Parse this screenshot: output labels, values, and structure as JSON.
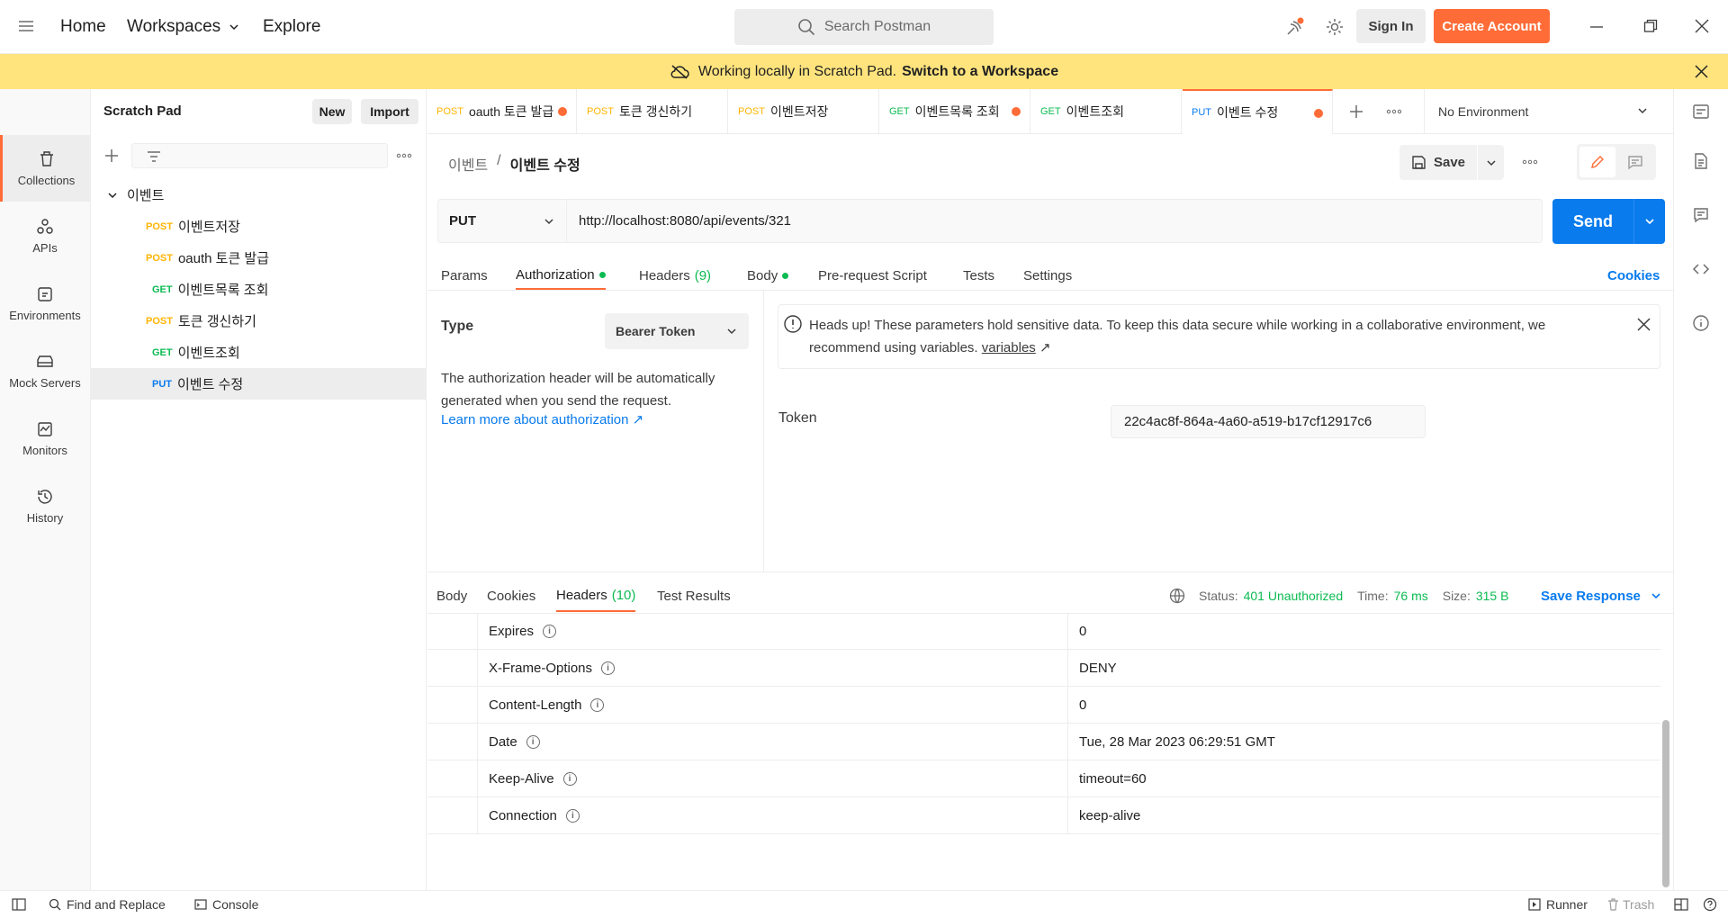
{
  "topbar": {
    "home": "Home",
    "workspaces": "Workspaces",
    "explore": "Explore",
    "search_placeholder": "Search Postman",
    "sign_in": "Sign In",
    "create_account": "Create Account"
  },
  "banner": {
    "text": "Working locally in Scratch Pad.",
    "link": "Switch to a Workspace"
  },
  "rail": {
    "items": [
      {
        "label": "Collections"
      },
      {
        "label": "APIs"
      },
      {
        "label": "Environments"
      },
      {
        "label": "Mock Servers"
      },
      {
        "label": "Monitors"
      },
      {
        "label": "History"
      }
    ]
  },
  "sidebar": {
    "title": "Scratch Pad",
    "new_label": "New",
    "import_label": "Import",
    "collection_name": "이벤트",
    "items": [
      {
        "method": "POST",
        "name": "이벤트저장"
      },
      {
        "method": "POST",
        "name": "oauth 토큰 발급"
      },
      {
        "method": "GET",
        "name": "이벤트목록 조회"
      },
      {
        "method": "POST",
        "name": "토큰 갱신하기"
      },
      {
        "method": "GET",
        "name": "이벤트조회"
      },
      {
        "method": "PUT",
        "name": "이벤트 수정"
      }
    ]
  },
  "tabs": [
    {
      "method": "POST",
      "name": "oauth 토큰 발급"
    },
    {
      "method": "POST",
      "name": "토큰 갱신하기"
    },
    {
      "method": "POST",
      "name": "이벤트저장"
    },
    {
      "method": "GET",
      "name": "이벤트목록 조회"
    },
    {
      "method": "GET",
      "name": "이벤트조회"
    },
    {
      "method": "PUT",
      "name": "이벤트 수정"
    }
  ],
  "environment": "No Environment",
  "request": {
    "breadcrumb_parent": "이벤트",
    "breadcrumb_sep": "/",
    "breadcrumb_current": "이벤트 수정",
    "save_label": "Save",
    "method": "PUT",
    "url": "http://localhost:8080/api/events/321",
    "send_label": "Send",
    "subtabs": {
      "params": "Params",
      "authorization": "Authorization",
      "headers": "Headers",
      "headers_count": "(9)",
      "body": "Body",
      "prerequest": "Pre-request Script",
      "tests": "Tests",
      "settings": "Settings"
    },
    "cookies_link": "Cookies"
  },
  "auth": {
    "type_label": "Type",
    "type_value": "Bearer Token",
    "description": "The authorization header will be automatically generated when you send the request.",
    "learn_more": "Learn more about authorization ↗",
    "alert_text": "Heads up! These parameters hold sensitive data. To keep this data secure while working in a collaborative environment, we recommend using variables.",
    "alert_link": "variables",
    "alert_arrow": "↗",
    "token_label": "Token",
    "token_value": "22c4ac8f-864a-4a60-a519-b17cf12917c6"
  },
  "response": {
    "tabs": {
      "body": "Body",
      "cookies": "Cookies",
      "headers": "Headers",
      "headers_count": "(10)",
      "test_results": "Test Results"
    },
    "status_label": "Status:",
    "status_value": "401 Unauthorized",
    "time_label": "Time:",
    "time_value": "76 ms",
    "size_label": "Size:",
    "size_value": "315 B",
    "save_response": "Save Response",
    "headers": [
      {
        "key": "Expires",
        "value": "0"
      },
      {
        "key": "X-Frame-Options",
        "value": "DENY"
      },
      {
        "key": "Content-Length",
        "value": "0"
      },
      {
        "key": "Date",
        "value": "Tue, 28 Mar 2023 06:29:51 GMT"
      },
      {
        "key": "Keep-Alive",
        "value": "timeout=60"
      },
      {
        "key": "Connection",
        "value": "keep-alive"
      }
    ]
  },
  "statusbar": {
    "find_replace": "Find and Replace",
    "console": "Console",
    "runner": "Runner",
    "trash": "Trash"
  },
  "colors": {
    "accent": "#ff6c37",
    "primary": "#097bed",
    "success": "#0cbb52",
    "post": "#ffb400",
    "banner": "#ffe47e"
  }
}
